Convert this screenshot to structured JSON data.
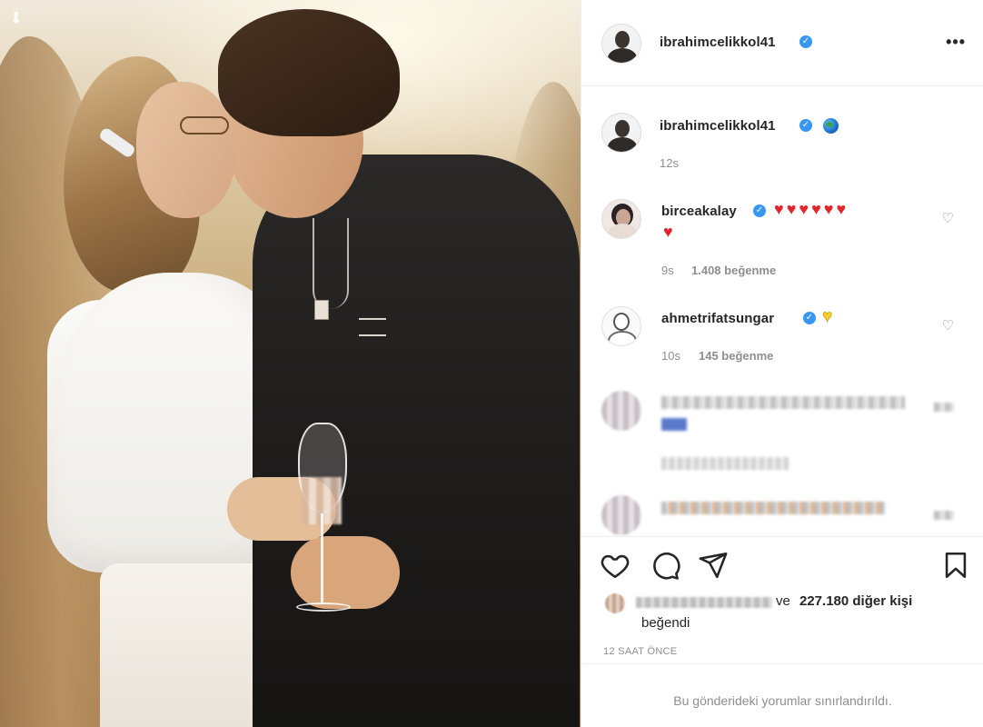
{
  "post": {
    "author": "ibrahimcelikkol41",
    "more_label": "•••"
  },
  "caption": {
    "author": "ibrahimcelikkol41",
    "time": "12s"
  },
  "comments": [
    {
      "author": "birceakalay",
      "text": "♥♥♥♥♥♥",
      "text_line2": "♥",
      "time": "9s",
      "likes": "1.408 beğenme"
    },
    {
      "author": "ahmetrifatsungar",
      "text": "♥",
      "time": "10s",
      "likes": "145 beğenme"
    }
  ],
  "likes": {
    "prefix": "ve",
    "count_text": "227.180 diğer kişi",
    "suffix": "beğendi"
  },
  "timestamp": "12 SAAT ÖNCE",
  "comments_limited": "Bu gönderideki yorumlar sınırlandırıldı.",
  "colors": {
    "verified": "#3897f0",
    "heart_red": "#e0262c",
    "heart_yellow": "#f7d02c"
  },
  "icons": [
    "download-icon",
    "more-icon",
    "verified-icon",
    "globe-icon",
    "like-icon",
    "comment-icon",
    "share-icon",
    "save-icon",
    "comment-like-icon"
  ]
}
